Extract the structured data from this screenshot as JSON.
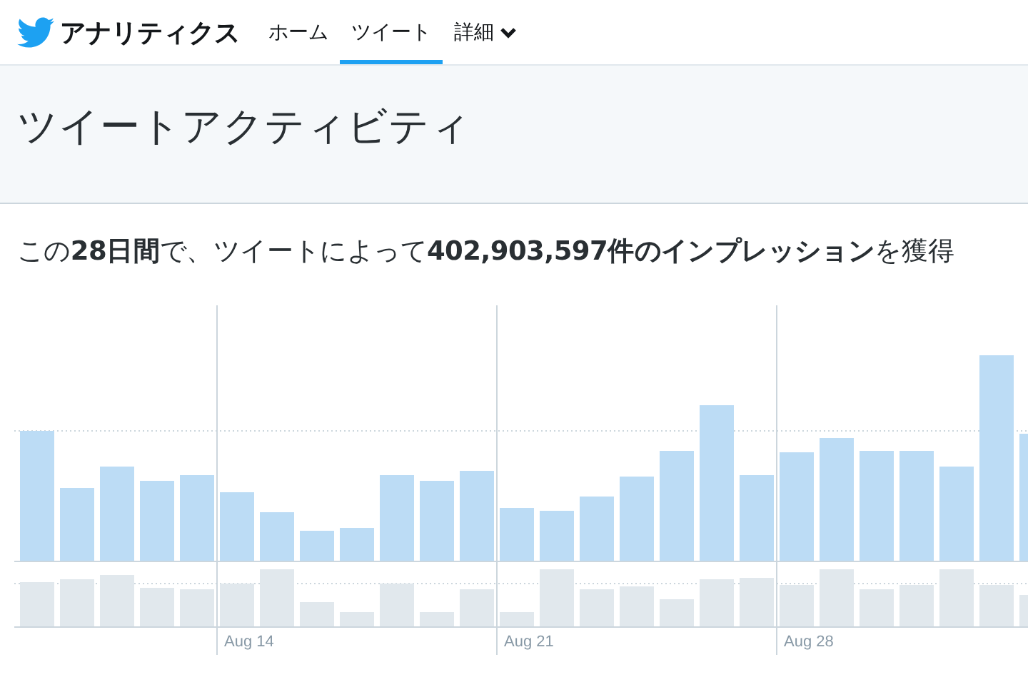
{
  "header": {
    "title": "アナリティクス",
    "nav": [
      {
        "label": "ホーム",
        "selected": false,
        "kind": "link"
      },
      {
        "label": "ツイート",
        "selected": true,
        "kind": "link"
      },
      {
        "label": "詳細",
        "selected": false,
        "kind": "dropdown"
      }
    ]
  },
  "page_title": "ツイートアクティビティ",
  "summary": "この**28日間**で、ツイートによって**402,903,597件のインプレッション**を獲得",
  "chart": {
    "x_labels": [
      "Aug 14",
      "Aug 21",
      "Aug 28"
    ]
  }
}
